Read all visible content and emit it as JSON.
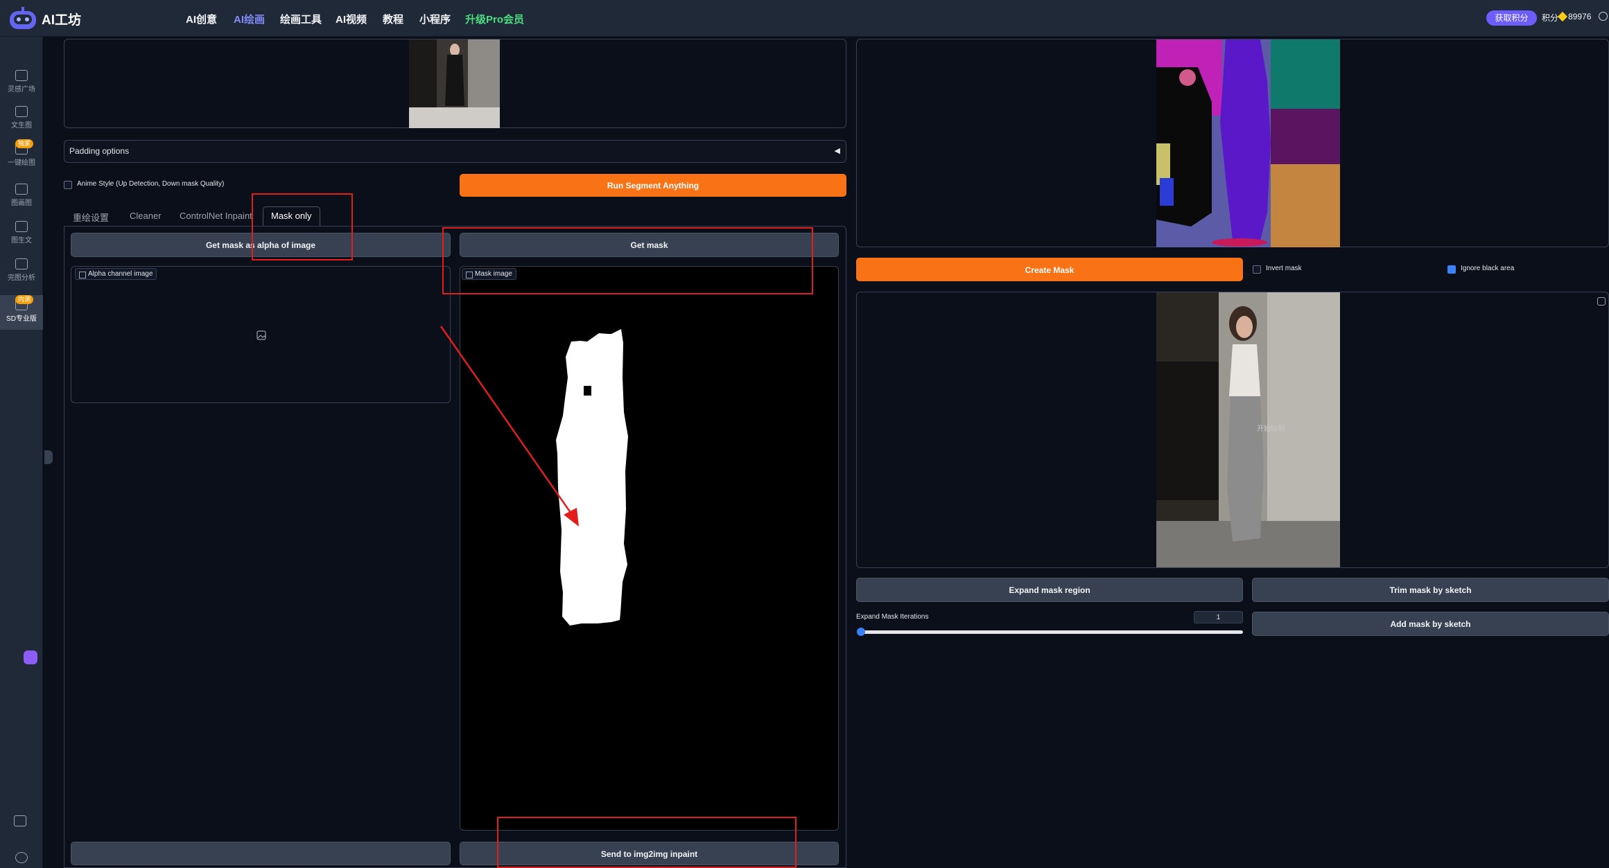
{
  "app": {
    "logo_text": "AI工坊"
  },
  "nav": [
    {
      "label": "AI创意"
    },
    {
      "label": "AI绘画"
    },
    {
      "label": "绘画工具"
    },
    {
      "label": "AI视频"
    },
    {
      "label": "教程"
    },
    {
      "label": "小程序"
    },
    {
      "label": "升级Pro会员"
    }
  ],
  "header": {
    "get_points": "获取积分",
    "points_label": "积分",
    "points_value": "89976"
  },
  "sidebar": [
    {
      "label": "灵感广场"
    },
    {
      "label": "文生图"
    },
    {
      "label": "一键绘图",
      "badge": "独家"
    },
    {
      "label": "图画图"
    },
    {
      "label": "图生文"
    },
    {
      "label": "完图分析"
    },
    {
      "label": "SD专业版",
      "badge": "内测"
    }
  ],
  "left": {
    "padding_options": "Padding options",
    "anime_style": "Anime Style (Up Detection, Down mask Quality)",
    "run_segment": "Run Segment Anything",
    "tabs": [
      "重绘设置",
      "Cleaner",
      "ControlNet Inpaint",
      "Mask only"
    ],
    "get_mask_alpha": "Get mask as alpha of image",
    "get_mask": "Get mask",
    "alpha_channel_label": "Alpha channel image",
    "mask_image_label": "Mask image",
    "send_inpaint": "Send to img2img inpaint"
  },
  "right": {
    "create_mask": "Create Mask",
    "invert_mask": "Invert mask",
    "ignore_black": "Ignore black area",
    "overlay_text": "开始绘制",
    "expand_mask": "Expand mask region",
    "trim_mask": "Trim mask by sketch",
    "expand_iter_label": "Expand Mask Iterations",
    "expand_iter_value": "1",
    "add_mask": "Add mask by sketch"
  }
}
